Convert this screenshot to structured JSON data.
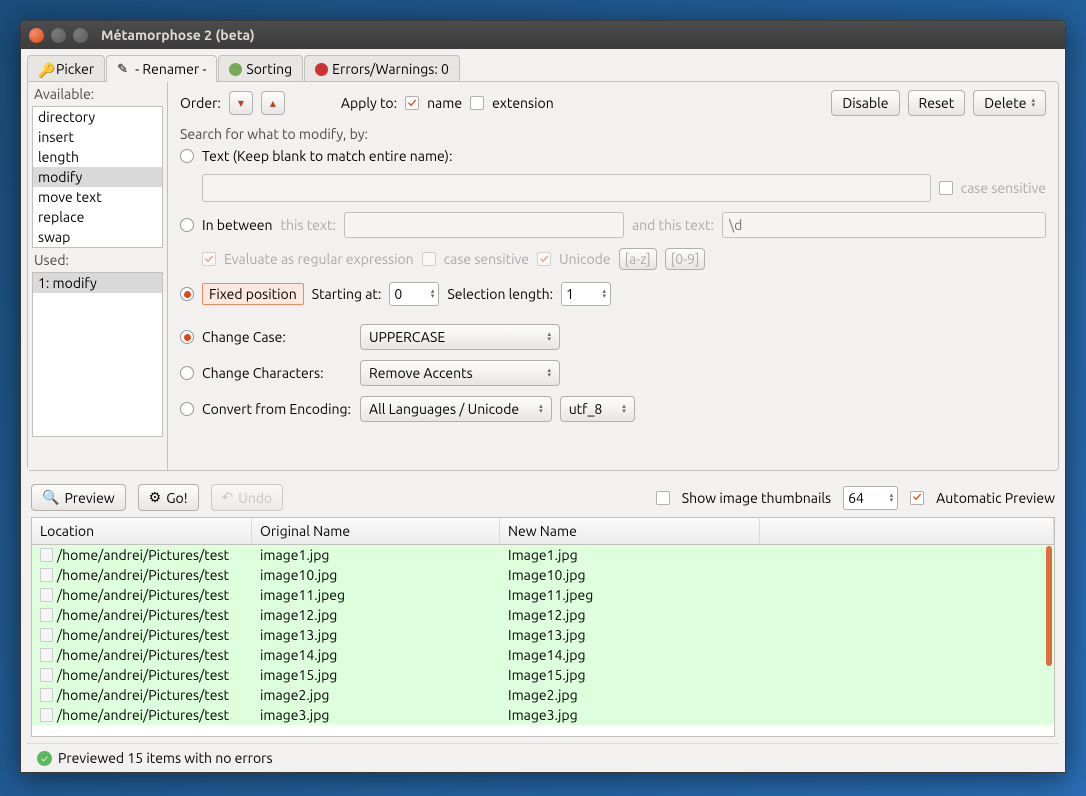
{
  "title": "Métamorphose 2 (beta)",
  "tabs": {
    "picker": "Picker",
    "renamer": "- Renamer -",
    "sorting": "Sorting",
    "errors": "Errors/Warnings: 0"
  },
  "sidebar": {
    "available_label": "Available:",
    "available": [
      "directory",
      "insert",
      "length",
      "modify",
      "move text",
      "replace",
      "swap"
    ],
    "used_label": "Used:",
    "used": [
      "1: modify"
    ]
  },
  "order": {
    "label": "Order:",
    "apply_to": "Apply to:",
    "name": "name",
    "extension": "extension"
  },
  "buttons": {
    "disable": "Disable",
    "reset": "Reset",
    "delete": "Delete",
    "preview": "Preview",
    "go": "Go!",
    "undo": "Undo",
    "az": "[a-z]",
    "n09": "[0-9]"
  },
  "search": {
    "label": "Search for what to modify, by:",
    "text_opt": "Text (Keep blank to match entire name):",
    "case_sensitive": "case sensitive",
    "in_between": "In between",
    "this_text": "this text:",
    "and_this_text": "and this text:",
    "regex_placeholder": "\\d",
    "eval_regex": "Evaluate as regular expression",
    "unicode": "Unicode",
    "fixed_position": "Fixed position",
    "starting_at": "Starting at:",
    "starting_val": "0",
    "selection_length": "Selection length:",
    "selection_val": "1"
  },
  "modify_opts": {
    "change_case": "Change Case:",
    "case_val": "UPPERCASE",
    "change_chars": "Change Characters:",
    "chars_val": "Remove Accents",
    "convert_enc": "Convert from Encoding:",
    "enc_val": "All Languages / Unicode",
    "enc_target": "utf_8"
  },
  "preview_bar": {
    "show_thumbs": "Show image thumbnails",
    "thumb_size": "64",
    "auto_preview": "Automatic Preview"
  },
  "table": {
    "headers": {
      "location": "Location",
      "original": "Original Name",
      "newname": "New Name"
    },
    "rows": [
      {
        "loc": "/home/andrei/Pictures/test",
        "on": "image1.jpg",
        "nn": "Image1.jpg"
      },
      {
        "loc": "/home/andrei/Pictures/test",
        "on": "image10.jpg",
        "nn": "Image10.jpg"
      },
      {
        "loc": "/home/andrei/Pictures/test",
        "on": "image11.jpeg",
        "nn": "Image11.jpeg"
      },
      {
        "loc": "/home/andrei/Pictures/test",
        "on": "image12.jpg",
        "nn": "Image12.jpg"
      },
      {
        "loc": "/home/andrei/Pictures/test",
        "on": "image13.jpg",
        "nn": "Image13.jpg"
      },
      {
        "loc": "/home/andrei/Pictures/test",
        "on": "image14.jpg",
        "nn": "Image14.jpg"
      },
      {
        "loc": "/home/andrei/Pictures/test",
        "on": "image15.jpg",
        "nn": "Image15.jpg"
      },
      {
        "loc": "/home/andrei/Pictures/test",
        "on": "image2.jpg",
        "nn": "Image2.jpg"
      },
      {
        "loc": "/home/andrei/Pictures/test",
        "on": "image3.jpg",
        "nn": "Image3.jpg"
      }
    ]
  },
  "status": "Previewed 15 items with no errors"
}
